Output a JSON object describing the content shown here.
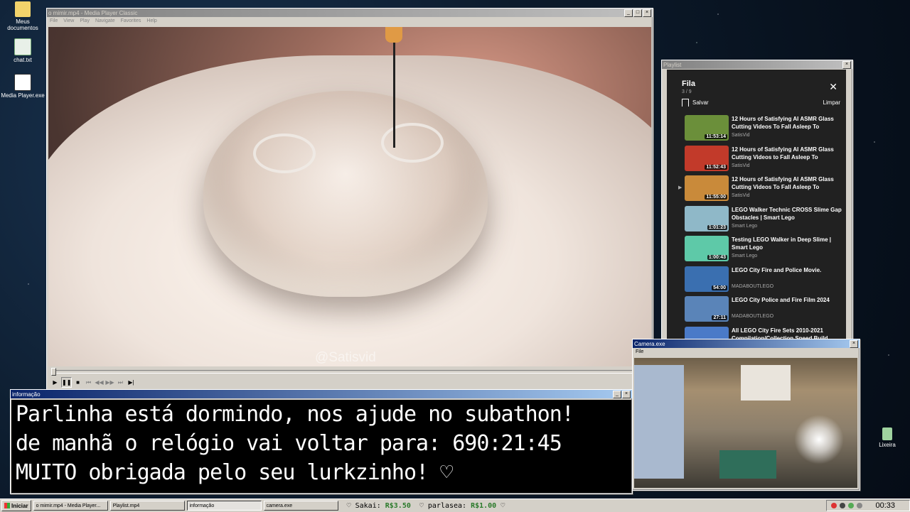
{
  "desktop": {
    "icons": [
      {
        "label": "Meus documentos",
        "icon": "folder-icon"
      },
      {
        "label": "chat.txt",
        "icon": "text-file-icon"
      },
      {
        "label": "Media Player.exe",
        "icon": "media-player-icon"
      },
      {
        "label": "Lixeira",
        "icon": "recycle-bin-icon"
      }
    ]
  },
  "player": {
    "title": "o mimir.mp4 - Media Player Classic",
    "menu": [
      "File",
      "View",
      "Play",
      "Navigate",
      "Favorites",
      "Help"
    ],
    "watermark": "@Satisvid"
  },
  "playlist_window": {
    "title": "Playlist",
    "queue_label": "Fila",
    "queue_count": "3 / 9",
    "save_label": "Salvar",
    "clear_label": "Limpar",
    "items": [
      {
        "title": "12 Hours of Satisfying AI ASMR Glass Cutting Videos To Fall Asleep To",
        "channel": "SatisVid",
        "duration": "11:53:14",
        "thumb_color": "#6b8f3a",
        "playing": false
      },
      {
        "title": "12 Hours of Satisfying AI ASMR Glass Cutting Videos to Fall Asleep To",
        "channel": "SatisVid",
        "duration": "11:52:43",
        "thumb_color": "#c23a2a",
        "playing": false
      },
      {
        "title": "12 Hours of Satisfying AI ASMR Glass Cutting Videos To Fall Asleep To",
        "channel": "SatisVid",
        "duration": "11:55:00",
        "thumb_color": "#c98a3a",
        "playing": true
      },
      {
        "title": "LEGO Walker Technic CROSS Slime Gap Obstacles | Smart Lego",
        "channel": "Smart Lego",
        "duration": "1:01:23",
        "thumb_color": "#8fb8c8",
        "playing": false
      },
      {
        "title": "Testing LEGO Walker in Deep Slime | Smart Lego",
        "channel": "Smart Lego",
        "duration": "1:00:43",
        "thumb_color": "#5ec9a8",
        "playing": false
      },
      {
        "title": "LEGO City Fire and Police Movie.",
        "channel": "MADABOUTLEGO",
        "duration": "54:00",
        "thumb_color": "#3a6fb0",
        "playing": false
      },
      {
        "title": "LEGO City Police and Fire Film 2024",
        "channel": "MADABOUTLEGO",
        "duration": "27:11",
        "thumb_color": "#5a84b8",
        "playing": false
      },
      {
        "title": "All LEGO City Fire Sets 2010-2021 Compilation/Collection Speed Build",
        "channel": "",
        "duration": "",
        "thumb_color": "#4a7ac8",
        "playing": false
      }
    ]
  },
  "info_window": {
    "title": "informação",
    "lines": [
      "Parlinha está dormindo, nos ajude no subathon!",
      "de manhã o relógio vai voltar para:  690:21:45",
      "MUITO obrigada pelo seu lurkzinho! ♡"
    ]
  },
  "camera_window": {
    "title": "Camera.exe",
    "menu": "File"
  },
  "taskbar": {
    "start_label": "Iniciar",
    "tasks": [
      {
        "label": "o mimir.mp4 - Media Player...",
        "active": false
      },
      {
        "label": "Playlist.mp4",
        "active": false
      },
      {
        "label": "informação",
        "active": true
      },
      {
        "label": "camera.exe",
        "active": false
      }
    ],
    "donations": [
      {
        "name": "Sakai:",
        "amount": "R$3.50"
      },
      {
        "name": "parlasea:",
        "amount": "R$1.00"
      }
    ],
    "clock": "00:33"
  }
}
